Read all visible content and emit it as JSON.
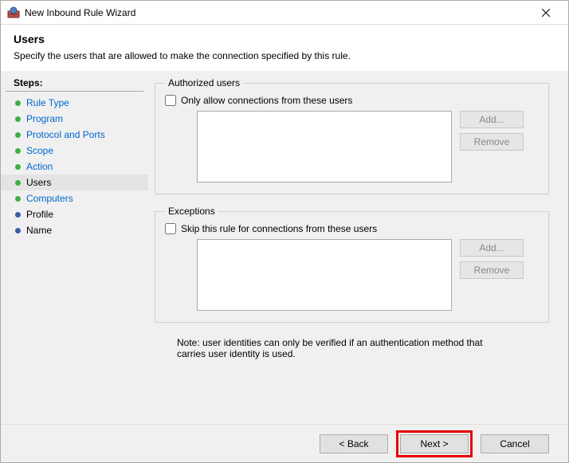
{
  "window": {
    "title": "New Inbound Rule Wizard"
  },
  "header": {
    "title": "Users",
    "subtitle": "Specify the users that are allowed to make the connection specified by this rule."
  },
  "sidebar": {
    "label": "Steps:",
    "items": [
      {
        "label": "Rule Type",
        "state": "done"
      },
      {
        "label": "Program",
        "state": "done"
      },
      {
        "label": "Protocol and Ports",
        "state": "done"
      },
      {
        "label": "Scope",
        "state": "done"
      },
      {
        "label": "Action",
        "state": "done"
      },
      {
        "label": "Users",
        "state": "current"
      },
      {
        "label": "Computers",
        "state": "done"
      },
      {
        "label": "Profile",
        "state": "pending"
      },
      {
        "label": "Name",
        "state": "pending"
      }
    ]
  },
  "groups": {
    "authorized": {
      "legend": "Authorized users",
      "checkbox_label": "Only allow connections from these users",
      "add_label": "Add...",
      "remove_label": "Remove"
    },
    "exceptions": {
      "legend": "Exceptions",
      "checkbox_label": "Skip this rule for connections from these users",
      "add_label": "Add...",
      "remove_label": "Remove"
    }
  },
  "note": "Note: user identities can only be verified if an authentication method that carries user identity is used.",
  "footer": {
    "back": "< Back",
    "next": "Next >",
    "cancel": "Cancel"
  }
}
